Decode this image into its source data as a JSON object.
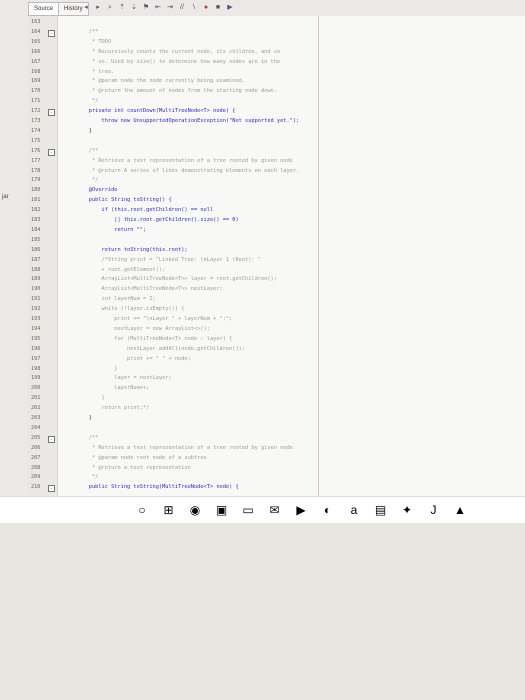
{
  "toolbar": {
    "source_tab": "Source",
    "history_tab": "History"
  },
  "sidebar": {
    "jar_label": "jar"
  },
  "editor": {
    "lines": [
      {
        "n": "163",
        "text": "",
        "cls": "plain"
      },
      {
        "n": "164",
        "text": "    /**",
        "cls": "comment"
      },
      {
        "n": "165",
        "text": "     * TODO",
        "cls": "comment"
      },
      {
        "n": "166",
        "text": "     * Recursively counts the current node, its children, and so",
        "cls": "comment"
      },
      {
        "n": "167",
        "text": "     * on. Used by size() to determine how many nodes are in the",
        "cls": "comment"
      },
      {
        "n": "168",
        "text": "     * tree.",
        "cls": "comment"
      },
      {
        "n": "169",
        "text": "     * @param node the node currently being examined.",
        "cls": "comment"
      },
      {
        "n": "170",
        "text": "     * @return the amount of nodes from the starting node down.",
        "cls": "comment"
      },
      {
        "n": "171",
        "text": "     */",
        "cls": "comment"
      },
      {
        "n": "172",
        "text": "    private int countDown(MultiTreeNode<T> node) {",
        "cls": "kw"
      },
      {
        "n": "173",
        "text": "        throw new UnsupportedOperationException(\"Not supported yet.\");",
        "cls": "kw"
      },
      {
        "n": "174",
        "text": "    }",
        "cls": "plain"
      },
      {
        "n": "175",
        "text": "",
        "cls": "plain"
      },
      {
        "n": "176",
        "text": "    /**",
        "cls": "comment"
      },
      {
        "n": "177",
        "text": "     * Retrieve a text representation of a tree rooted by given node",
        "cls": "comment"
      },
      {
        "n": "178",
        "text": "     * @return A series of lines demonstrating elements on each layer.",
        "cls": "comment"
      },
      {
        "n": "179",
        "text": "     */",
        "cls": "comment"
      },
      {
        "n": "180",
        "text": "    @Override",
        "cls": "kw"
      },
      {
        "n": "181",
        "text": "    public String toString() {",
        "cls": "kw"
      },
      {
        "n": "182",
        "text": "        if (this.root.getChildren() == null",
        "cls": "kw"
      },
      {
        "n": "183",
        "text": "            || this.root.getChildren().size() == 0)",
        "cls": "kw"
      },
      {
        "n": "184",
        "text": "            return \"\";",
        "cls": "kw"
      },
      {
        "n": "185",
        "text": "",
        "cls": "plain"
      },
      {
        "n": "186",
        "text": "        return toString(this.root);",
        "cls": "kw"
      },
      {
        "n": "187",
        "text": "        /*String print = \"Linked Tree: \\nLayer 1 (Root): \"",
        "cls": "comment"
      },
      {
        "n": "188",
        "text": "        + root.getElement();",
        "cls": "comment"
      },
      {
        "n": "189",
        "text": "        ArrayList<MultiTreeNode<T>> layer = root.getChildren();",
        "cls": "comment"
      },
      {
        "n": "190",
        "text": "        ArrayList<MultiTreeNode<T>> nextLayer;",
        "cls": "comment"
      },
      {
        "n": "191",
        "text": "        int layerNum = 2;",
        "cls": "comment"
      },
      {
        "n": "192",
        "text": "        while (!layer.isEmpty()) {",
        "cls": "comment"
      },
      {
        "n": "193",
        "text": "            print += \"\\nLayer \" + layerNum + \":\";",
        "cls": "comment"
      },
      {
        "n": "194",
        "text": "            nextLayer = new ArrayList<>();",
        "cls": "comment"
      },
      {
        "n": "195",
        "text": "            for (MultiTreeNode<T> node : layer) {",
        "cls": "comment"
      },
      {
        "n": "196",
        "text": "                nextLayer.addAll(node.getChildren());",
        "cls": "comment"
      },
      {
        "n": "197",
        "text": "                print += \" \" + node;",
        "cls": "comment"
      },
      {
        "n": "198",
        "text": "            }",
        "cls": "comment"
      },
      {
        "n": "199",
        "text": "            layer = nextLayer;",
        "cls": "comment"
      },
      {
        "n": "200",
        "text": "            layerNum++;",
        "cls": "comment"
      },
      {
        "n": "201",
        "text": "        }",
        "cls": "comment"
      },
      {
        "n": "202",
        "text": "        return print;*/",
        "cls": "comment"
      },
      {
        "n": "203",
        "text": "    }",
        "cls": "plain"
      },
      {
        "n": "204",
        "text": "",
        "cls": "plain"
      },
      {
        "n": "205",
        "text": "    /**",
        "cls": "comment"
      },
      {
        "n": "206",
        "text": "     * Retrieve a text representation of a tree rooted by given node",
        "cls": "comment"
      },
      {
        "n": "207",
        "text": "     * @param node root node of a subtree",
        "cls": "comment"
      },
      {
        "n": "208",
        "text": "     * @return a text representation",
        "cls": "comment"
      },
      {
        "n": "209",
        "text": "     */",
        "cls": "comment"
      },
      {
        "n": "210",
        "text": "    public String toString(MultiTreeNode<T> node) {",
        "cls": "kw"
      }
    ]
  },
  "taskbar": {
    "items": [
      {
        "name": "search-circle-icon",
        "glyph": "○"
      },
      {
        "name": "task-view-icon",
        "glyph": "⊞"
      },
      {
        "name": "edge-browser-icon",
        "glyph": "◉"
      },
      {
        "name": "store-icon",
        "glyph": "▣"
      },
      {
        "name": "file-explorer-icon",
        "glyph": "▭"
      },
      {
        "name": "mail-icon",
        "glyph": "✉"
      },
      {
        "name": "jetbrains-icon",
        "glyph": "▶"
      },
      {
        "name": "office-icon",
        "glyph": "◐"
      },
      {
        "name": "java-icon",
        "glyph": "a"
      },
      {
        "name": "dev-icon",
        "glyph": "▤"
      },
      {
        "name": "dropbox-icon",
        "glyph": "✦"
      },
      {
        "name": "java-j-icon",
        "glyph": "J"
      },
      {
        "name": "apex-icon",
        "glyph": "▲"
      }
    ]
  }
}
